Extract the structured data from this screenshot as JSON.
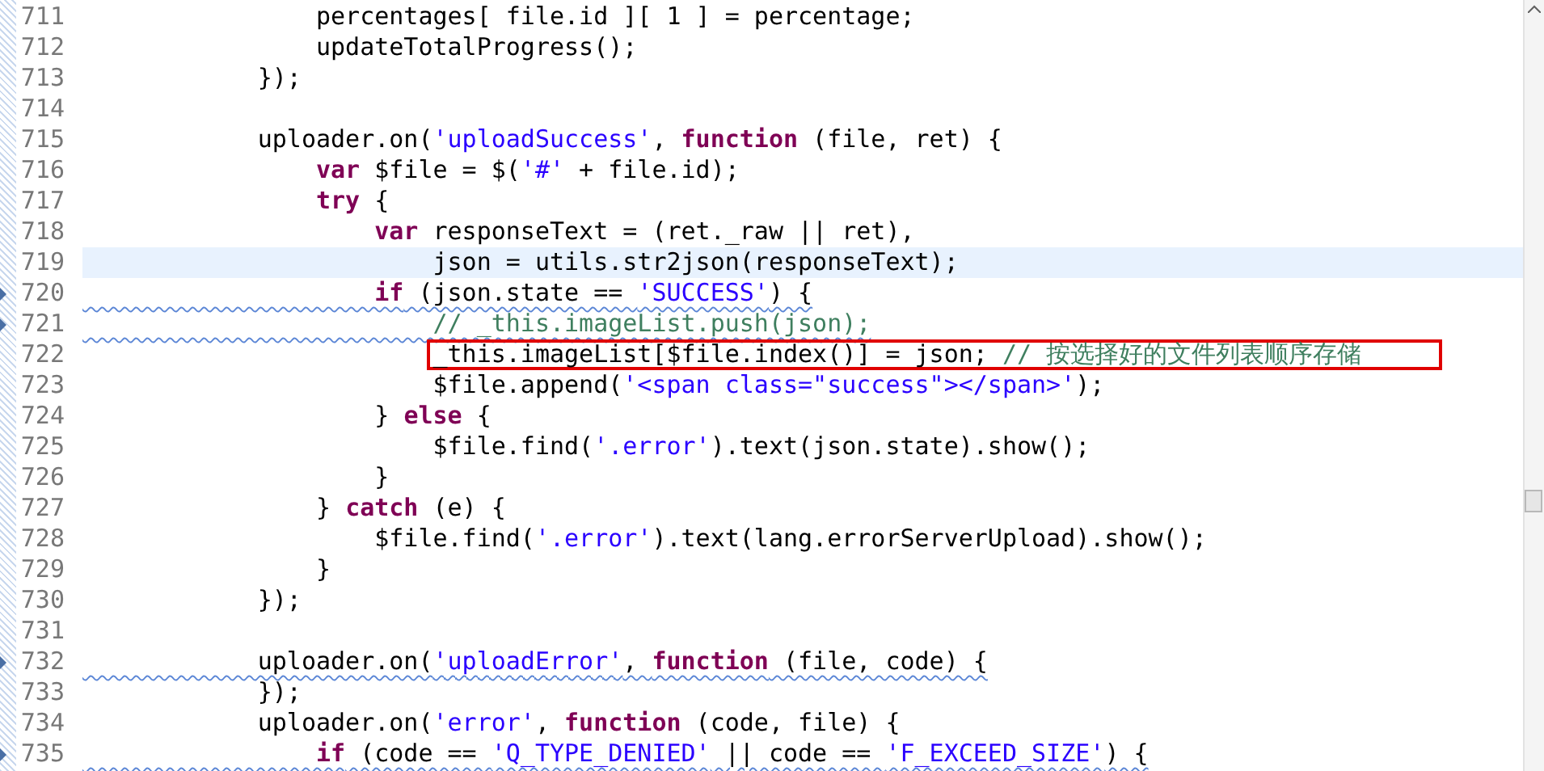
{
  "editor": {
    "lines": [
      {
        "number": "711",
        "current": false,
        "warning": false,
        "segments": [
          {
            "kind": "plain",
            "text": "                percentages[ file.id ][ 1 ] = percentage;"
          }
        ]
      },
      {
        "number": "712",
        "current": false,
        "warning": false,
        "segments": [
          {
            "kind": "plain",
            "text": "                updateTotalProgress();"
          }
        ]
      },
      {
        "number": "713",
        "current": false,
        "warning": false,
        "segments": [
          {
            "kind": "plain",
            "text": "            });"
          }
        ]
      },
      {
        "number": "714",
        "current": false,
        "warning": false
      },
      {
        "number": "715",
        "current": false,
        "warning": false,
        "segments": [
          {
            "kind": "plain",
            "text": "            uploader.on("
          },
          {
            "kind": "string",
            "text": "'uploadSuccess'"
          },
          {
            "kind": "plain",
            "text": ", "
          },
          {
            "kind": "keyword",
            "text": "function"
          },
          {
            "kind": "plain",
            "text": " (file, ret) {"
          }
        ]
      },
      {
        "number": "716",
        "current": false,
        "warning": false,
        "segments": [
          {
            "kind": "keyword",
            "text": "                var"
          },
          {
            "kind": "plain",
            "text": " $file = $("
          },
          {
            "kind": "string",
            "text": "'#'"
          },
          {
            "kind": "plain",
            "text": " + file.id);"
          }
        ]
      },
      {
        "number": "717",
        "current": false,
        "warning": false,
        "segments": [
          {
            "kind": "keyword",
            "text": "                try"
          },
          {
            "kind": "plain",
            "text": " {"
          }
        ]
      },
      {
        "number": "718",
        "current": false,
        "warning": false,
        "segments": [
          {
            "kind": "keyword",
            "text": "                    var"
          },
          {
            "kind": "plain",
            "text": " responseText = (ret._raw || ret),"
          }
        ]
      },
      {
        "number": "719",
        "current": true,
        "warning": false,
        "segments": [
          {
            "kind": "plain",
            "text": "                        json = utils.str2json(responseText);"
          }
        ]
      },
      {
        "number": "720",
        "current": false,
        "warning": true,
        "segments": [
          {
            "kind": "keyword",
            "text": "                    if"
          },
          {
            "kind": "plain",
            "text": " (json.state == "
          },
          {
            "kind": "string",
            "text": "'SUCCESS'"
          },
          {
            "kind": "plain",
            "text": ") {"
          }
        ]
      },
      {
        "number": "721",
        "current": false,
        "warning": true,
        "segments": [
          {
            "kind": "comment",
            "text": "                        // _this.imageList.push(json);"
          }
        ]
      },
      {
        "number": "722",
        "current": false,
        "warning": false,
        "segments": [
          {
            "kind": "plain",
            "text": "                        _this.imageList[$file.index()] = json; ",
            "boxed": true
          },
          {
            "kind": "comment",
            "text": "// 按选择好的文件列表顺序存储",
            "boxed": true
          }
        ]
      },
      {
        "number": "723",
        "current": false,
        "warning": false,
        "segments": [
          {
            "kind": "plain",
            "text": "                        $file.append("
          },
          {
            "kind": "string",
            "text": "'<span class=\"success\"></span>'"
          },
          {
            "kind": "plain",
            "text": ");"
          }
        ]
      },
      {
        "number": "724",
        "current": false,
        "warning": false,
        "segments": [
          {
            "kind": "plain",
            "text": "                    } "
          },
          {
            "kind": "keyword",
            "text": "else"
          },
          {
            "kind": "plain",
            "text": " {"
          }
        ]
      },
      {
        "number": "725",
        "current": false,
        "warning": false,
        "segments": [
          {
            "kind": "plain",
            "text": "                        $file.find("
          },
          {
            "kind": "string",
            "text": "'.error'"
          },
          {
            "kind": "plain",
            "text": ").text(json.state).show();"
          }
        ]
      },
      {
        "number": "726",
        "current": false,
        "warning": false,
        "segments": [
          {
            "kind": "plain",
            "text": "                    }"
          }
        ]
      },
      {
        "number": "727",
        "current": false,
        "warning": false,
        "segments": [
          {
            "kind": "plain",
            "text": "                } "
          },
          {
            "kind": "keyword",
            "text": "catch"
          },
          {
            "kind": "plain",
            "text": " (e) {"
          }
        ]
      },
      {
        "number": "728",
        "current": false,
        "warning": false,
        "segments": [
          {
            "kind": "plain",
            "text": "                    $file.find("
          },
          {
            "kind": "string",
            "text": "'.error'"
          },
          {
            "kind": "plain",
            "text": ").text(lang.errorServerUpload).show();"
          }
        ]
      },
      {
        "number": "729",
        "current": false,
        "warning": false,
        "segments": [
          {
            "kind": "plain",
            "text": "                }"
          }
        ]
      },
      {
        "number": "730",
        "current": false,
        "warning": false,
        "segments": [
          {
            "kind": "plain",
            "text": "            });"
          }
        ]
      },
      {
        "number": "731",
        "current": false,
        "warning": false
      },
      {
        "number": "732",
        "current": false,
        "warning": true,
        "segments": [
          {
            "kind": "plain",
            "text": "            uploader.on("
          },
          {
            "kind": "string",
            "text": "'uploadError'"
          },
          {
            "kind": "plain",
            "text": ", "
          },
          {
            "kind": "keyword",
            "text": "function"
          },
          {
            "kind": "plain",
            "text": " (file, code) {"
          }
        ]
      },
      {
        "number": "733",
        "current": false,
        "warning": false,
        "segments": [
          {
            "kind": "plain",
            "text": "            });"
          }
        ]
      },
      {
        "number": "734",
        "current": false,
        "warning": false,
        "segments": [
          {
            "kind": "plain",
            "text": "            uploader.on("
          },
          {
            "kind": "string",
            "text": "'error'"
          },
          {
            "kind": "plain",
            "text": ", "
          },
          {
            "kind": "keyword",
            "text": "function"
          },
          {
            "kind": "plain",
            "text": " (code, file) {"
          }
        ]
      },
      {
        "number": "735",
        "current": false,
        "warning": true,
        "segments": [
          {
            "kind": "keyword",
            "text": "                if"
          },
          {
            "kind": "plain",
            "text": " (code == "
          },
          {
            "kind": "string",
            "text": "'Q_TYPE_DENIED'"
          },
          {
            "kind": "plain",
            "text": " || code == "
          },
          {
            "kind": "string",
            "text": "'F_EXCEED_SIZE'"
          },
          {
            "kind": "plain",
            "text": ") {"
          }
        ]
      }
    ]
  }
}
